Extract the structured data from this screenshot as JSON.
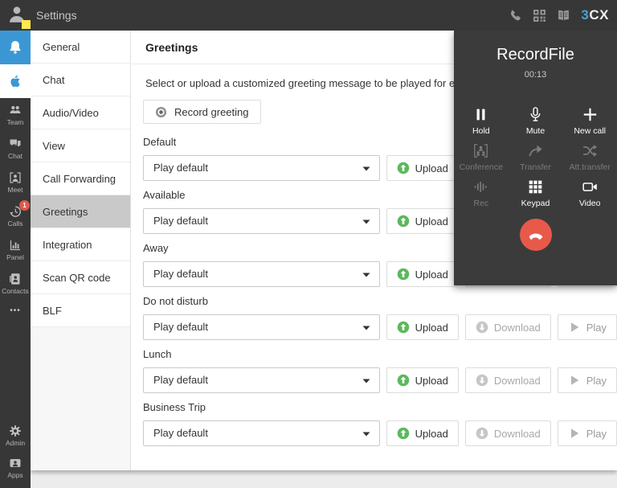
{
  "topbar": {
    "title": "Settings",
    "logo_3": "3",
    "logo_cx": "CX"
  },
  "sidebar": {
    "items": [
      {
        "label": "Team"
      },
      {
        "label": "Chat"
      },
      {
        "label": "Meet"
      },
      {
        "label": "Calls",
        "badge": "1"
      },
      {
        "label": "Panel"
      },
      {
        "label": "Contacts"
      }
    ],
    "more": "•••",
    "admin": {
      "label": "Admin"
    },
    "apps": {
      "label": "Apps"
    }
  },
  "settings_menu": {
    "items": [
      {
        "label": "General"
      },
      {
        "label": "Chat"
      },
      {
        "label": "Audio/Video"
      },
      {
        "label": "View"
      },
      {
        "label": "Call Forwarding"
      },
      {
        "label": "Greetings"
      },
      {
        "label": "Integration"
      },
      {
        "label": "Scan QR code"
      },
      {
        "label": "BLF"
      }
    ],
    "selected": "Greetings"
  },
  "main": {
    "title": "Greetings",
    "description": "Select or upload a customized greeting message to be played for each profile",
    "record_button": "Record greeting",
    "select_value": "Play default",
    "actions": {
      "upload": "Upload",
      "download": "Download",
      "play": "Play"
    },
    "rows": [
      {
        "label": "Default"
      },
      {
        "label": "Available"
      },
      {
        "label": "Away"
      },
      {
        "label": "Do not disturb"
      },
      {
        "label": "Lunch"
      },
      {
        "label": "Business Trip"
      }
    ]
  },
  "call_panel": {
    "title": "RecordFile",
    "timer": "00:13",
    "controls": [
      {
        "label": "Hold",
        "enabled": true
      },
      {
        "label": "Mute",
        "enabled": true
      },
      {
        "label": "New call",
        "enabled": true
      },
      {
        "label": "Conference",
        "enabled": false
      },
      {
        "label": "Transfer",
        "enabled": false
      },
      {
        "label": "Att.transfer",
        "enabled": false
      },
      {
        "label": "Rec",
        "enabled": false
      },
      {
        "label": "Keypad",
        "enabled": true
      },
      {
        "label": "Video",
        "enabled": true
      }
    ]
  },
  "colors": {
    "accent_blue": "#3b97d3",
    "badge_red": "#e0584b",
    "hangup_red": "#e8594a",
    "upload_green": "#5cb85c",
    "dark_bg": "#373737",
    "selected_menu": "#c9c9c9",
    "status_yellow": "#ffe94e"
  }
}
